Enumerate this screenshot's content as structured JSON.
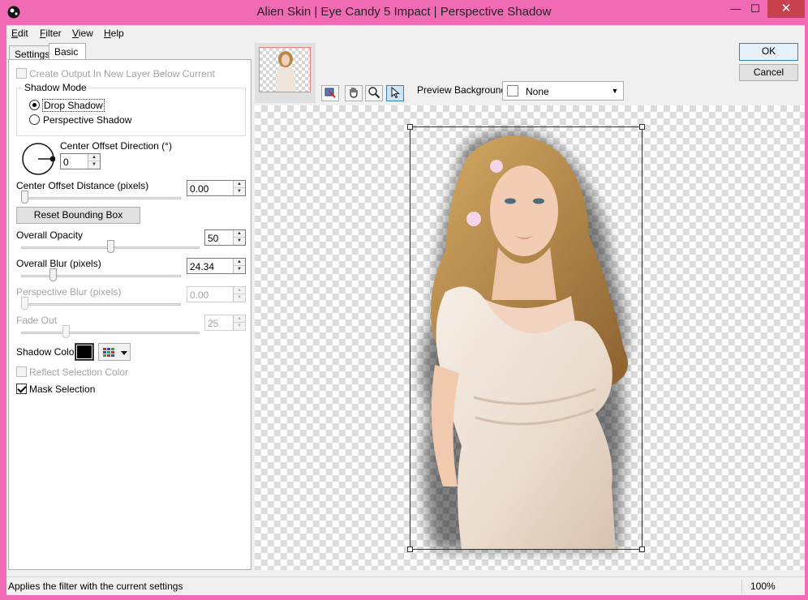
{
  "window": {
    "title": "Alien Skin | Eye Candy 5 Impact | Perspective Shadow",
    "minimize_glyph": "—",
    "maximize_glyph": "☐",
    "close_glyph": "✕",
    "frame_color": "#f06bb4"
  },
  "menu": {
    "items": [
      {
        "label": "Edit",
        "mnemonic": "E",
        "rest": "dit"
      },
      {
        "label": "Filter",
        "mnemonic": "F",
        "rest": "ilter"
      },
      {
        "label": "View",
        "mnemonic": "V",
        "rest": "iew"
      },
      {
        "label": "Help",
        "mnemonic": "H",
        "rest": "elp"
      }
    ]
  },
  "tabs": {
    "settings": "Settings",
    "basic": "Basic",
    "active": "Basic"
  },
  "basic": {
    "create_output": {
      "label": "Create Output In New Layer Below Current",
      "checked": false,
      "enabled": false
    },
    "shadow_mode": {
      "title": "Shadow Mode",
      "options": [
        "Drop Shadow",
        "Perspective Shadow"
      ],
      "selected": "Drop Shadow"
    },
    "center_offset_direction": {
      "label": "Center Offset Direction (°)",
      "value": "0"
    },
    "center_offset_distance": {
      "label": "Center Offset Distance (pixels)",
      "value": "0.00",
      "slider_fraction": 0.02
    },
    "reset_bounding_box": "Reset Bounding Box",
    "overall_opacity": {
      "label": "Overall Opacity",
      "value": "50",
      "slider_fraction": 0.5
    },
    "overall_blur": {
      "label": "Overall Blur (pixels)",
      "value": "24.34",
      "slider_fraction": 0.2
    },
    "perspective_blur": {
      "label": "Perspective Blur (pixels)",
      "value": "0.00",
      "slider_fraction": 0.02,
      "enabled": false
    },
    "fade_out": {
      "label": "Fade Out",
      "value": "25",
      "slider_fraction": 0.25,
      "enabled": false
    },
    "shadow_color": {
      "label": "Shadow Color",
      "color": "#000000"
    },
    "reflect_selection_color": {
      "label": "Reflect Selection Color",
      "checked": false,
      "enabled": false
    },
    "mask_selection": {
      "label": "Mask Selection",
      "checked": true,
      "enabled": true
    }
  },
  "preview": {
    "background_label": "Preview Background:",
    "background_value": "None",
    "tools": [
      "navigate-icon",
      "hand-icon",
      "zoom-icon",
      "pointer-icon"
    ],
    "active_tool": "pointer-icon"
  },
  "buttons": {
    "ok": "OK",
    "cancel": "Cancel"
  },
  "status": {
    "message": "Applies the filter with the current settings",
    "zoom": "100%"
  }
}
